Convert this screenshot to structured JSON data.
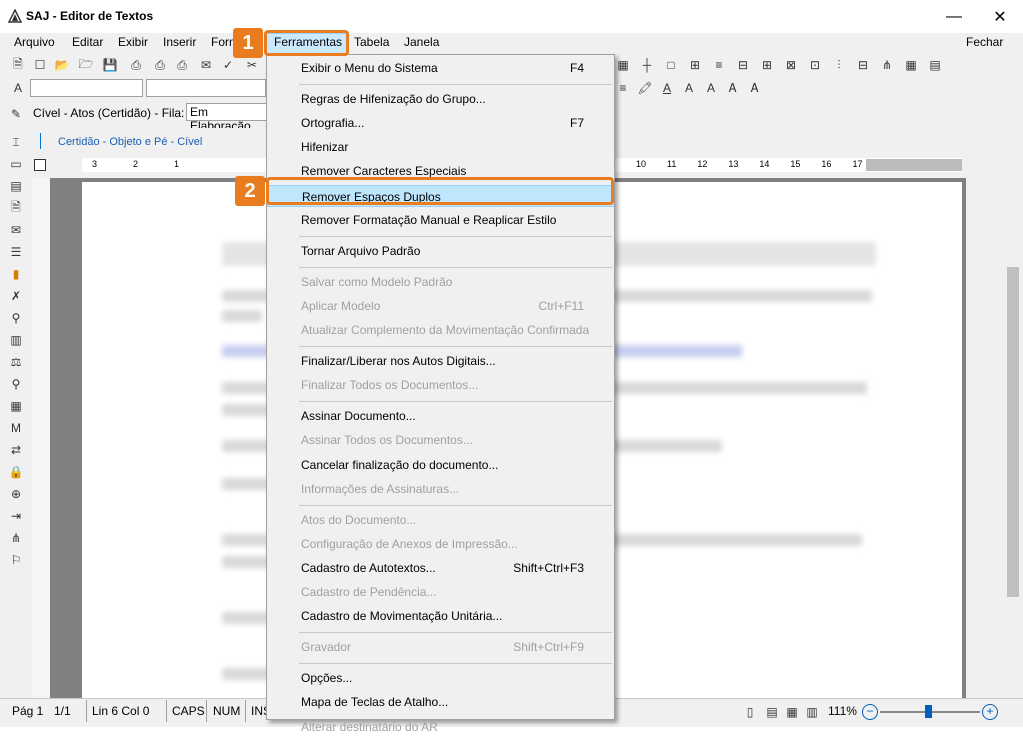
{
  "window": {
    "title": "SAJ - Editor de Textos",
    "minimize": "—",
    "maximize": "☐",
    "close": "✕"
  },
  "menubar": {
    "items": [
      "Arquivo",
      "Editar",
      "Exibir",
      "Inserir",
      "Form",
      "Ferramentas",
      "Tabela",
      "Janela"
    ],
    "fechar": "Fechar"
  },
  "context": {
    "label": "Cível - Atos (Certidão) - Fila:",
    "fila_value": "Em Elaboração"
  },
  "tab": {
    "label": "Certidão - Objeto e Pé - Cível"
  },
  "ruler": {
    "left_ticks": [
      "3",
      "2",
      "1"
    ],
    "right_ticks": [
      "10",
      "11",
      "12",
      "13",
      "14",
      "15",
      "16",
      "17"
    ]
  },
  "menu": {
    "items": [
      {
        "label": "Exibir o Menu do Sistema",
        "shortcut": "F4",
        "disabled": false
      },
      {
        "sep": true
      },
      {
        "label": "Regras de Hifenização do Grupo...",
        "shortcut": "",
        "disabled": false
      },
      {
        "label": "Ortografia...",
        "shortcut": "F7",
        "disabled": false
      },
      {
        "label": "Hifenizar",
        "shortcut": "",
        "disabled": false
      },
      {
        "label": "Remover Caracteres Especiais",
        "shortcut": "",
        "disabled": false
      },
      {
        "label": "Remover Espaços Duplos",
        "shortcut": "",
        "disabled": false,
        "highlighted": true
      },
      {
        "label": "Remover Formatação Manual e Reaplicar Estilo",
        "shortcut": "",
        "disabled": false
      },
      {
        "sep": true
      },
      {
        "label": "Tornar Arquivo Padrão",
        "shortcut": "",
        "disabled": false
      },
      {
        "sep": true
      },
      {
        "label": "Salvar como Modelo Padrão",
        "shortcut": "",
        "disabled": true
      },
      {
        "label": "Aplicar Modelo",
        "shortcut": "Ctrl+F11",
        "disabled": true
      },
      {
        "label": "Atualizar Complemento da Movimentação Confirmada",
        "shortcut": "",
        "disabled": true
      },
      {
        "sep": true
      },
      {
        "label": "Finalizar/Liberar nos Autos Digitais...",
        "shortcut": "",
        "disabled": false
      },
      {
        "label": "Finalizar Todos os Documentos...",
        "shortcut": "",
        "disabled": true
      },
      {
        "sep": true
      },
      {
        "label": "Assinar Documento...",
        "shortcut": "",
        "disabled": false
      },
      {
        "label": "Assinar Todos os Documentos...",
        "shortcut": "",
        "disabled": true
      },
      {
        "label": "Cancelar finalização do documento...",
        "shortcut": "",
        "disabled": false
      },
      {
        "label": "Informações de Assinaturas...",
        "shortcut": "",
        "disabled": true
      },
      {
        "sep": true
      },
      {
        "label": "Atos do Documento...",
        "shortcut": "",
        "disabled": true
      },
      {
        "label": "Configuração de Anexos de Impressão...",
        "shortcut": "",
        "disabled": true
      },
      {
        "label": "Cadastro de Autotextos...",
        "shortcut": "Shift+Ctrl+F3",
        "disabled": false
      },
      {
        "label": "Cadastro de Pendência...",
        "shortcut": "",
        "disabled": true
      },
      {
        "label": "Cadastro de Movimentação Unitária...",
        "shortcut": "",
        "disabled": false
      },
      {
        "sep": true
      },
      {
        "label": "Gravador",
        "shortcut": "Shift+Ctrl+F9",
        "disabled": true
      },
      {
        "sep": true
      },
      {
        "label": "Opções...",
        "shortcut": "",
        "disabled": false
      },
      {
        "label": "Mapa de Teclas de Atalho...",
        "shortcut": "",
        "disabled": false
      },
      {
        "label": "Alterar destinatário do AR",
        "shortcut": "",
        "disabled": true
      }
    ]
  },
  "annotations": {
    "step1": "1",
    "step2": "2",
    "accent": "#e87c1e"
  },
  "status": {
    "page": "Pág 1",
    "pages": "1/1",
    "pos": "Lin 6  Col 0",
    "caps": "CAPS",
    "num": "NUM",
    "ins": "INS",
    "zoom": "111%"
  }
}
